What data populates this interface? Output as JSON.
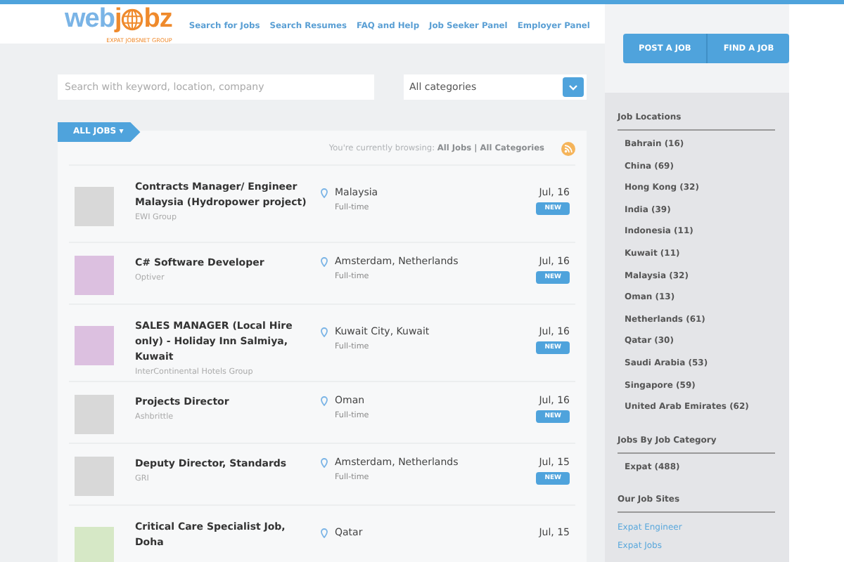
{
  "logo": {
    "part1": "web",
    "part2": "j",
    "part3": "bz",
    "tagline": "EXPAT JOBSNET GROUP"
  },
  "nav": [
    "Search for Jobs",
    "Search Resumes",
    "FAQ and Help",
    "Job Seeker Panel",
    "Employer Panel"
  ],
  "header_buttons": [
    "POST A JOB",
    "FIND A JOB"
  ],
  "search": {
    "placeholder": "Search with keyword, location, company"
  },
  "category_select": {
    "value": "All categories"
  },
  "tab": {
    "label": "ALL JOBS ▾"
  },
  "browsing": "You're currently browsing: **All Jobs | All Categories**",
  "jobs": [
    {
      "title": "Contracts Manager/ Engineer Malaysia (Hydropower project)",
      "company": "EWI Group",
      "location": "Malaysia",
      "type": "Full-time",
      "date": "Jul, 16",
      "badge": "NEW",
      "color": "#d8d8d8"
    },
    {
      "title": "C# Software Developer",
      "company": "Optiver",
      "location": "Amsterdam, Netherlands",
      "type": "Full-time",
      "date": "Jul, 16",
      "badge": "NEW",
      "color": "#dcc0e0"
    },
    {
      "title": "SALES MANAGER (Local Hire only) - Holiday Inn Salmiya, Kuwait",
      "company": "InterContinental Hotels Group",
      "location": "Kuwait City, Kuwait",
      "type": "Full-time",
      "date": "Jul, 16",
      "badge": "NEW",
      "color": "#dcc0e0"
    },
    {
      "title": "Projects Director",
      "company": "Ashbrittle",
      "location": "Oman",
      "type": "Full-time",
      "date": "Jul, 16",
      "badge": "NEW",
      "color": "#d8d8d8"
    },
    {
      "title": "Deputy Director, Standards",
      "company": "GRI",
      "location": "Amsterdam, Netherlands",
      "type": "Full-time",
      "date": "Jul, 15",
      "badge": "NEW",
      "color": "#d8d8d8"
    },
    {
      "title": "Critical Care Specialist Job, Doha",
      "location": "Qatar",
      "date": "Jul, 15",
      "color": "#d6e8c6"
    }
  ],
  "sidebar": [
    {
      "heading": "Job Locations",
      "items": [
        "Bahrain (16)",
        "China (69)",
        "Hong Kong (32)",
        "India (39)",
        "Indonesia (11)",
        "Kuwait (11)",
        "Malaysia (32)",
        "Oman (13)",
        "Netherlands (61)",
        "Qatar (30)",
        "Saudi Arabia (53)",
        "Singapore (59)",
        "United Arab Emirates (62)"
      ],
      "kind": "plain"
    },
    {
      "heading": "Jobs By Job Category",
      "items": [
        "Expat (488)"
      ],
      "kind": "plain"
    },
    {
      "heading": "Our Job Sites",
      "items": [
        "Expat Engineer",
        "Expat Jobs"
      ],
      "kind": "link"
    }
  ]
}
